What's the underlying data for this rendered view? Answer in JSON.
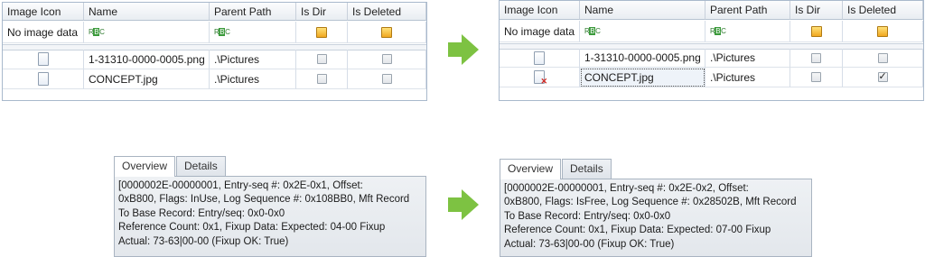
{
  "columns": [
    "Image Icon",
    "Name",
    "Parent Path",
    "Is Dir",
    "Is Deleted"
  ],
  "filter_row": {
    "image_icon": "No image data"
  },
  "before": {
    "rows": [
      {
        "name": "1-31310-0000-0005.png",
        "parent_path": ".\\Pictures",
        "is_dir": false,
        "is_deleted": false,
        "icon": "file-icon"
      },
      {
        "name": "CONCEPT.jpg",
        "parent_path": ".\\Pictures",
        "is_dir": false,
        "is_deleted": false,
        "icon": "file-icon"
      }
    ],
    "tabs": [
      "Overview",
      "Details"
    ],
    "active_tab": "Overview",
    "overview_lines": [
      "[0000002E-00000001, Entry-seq #: 0x2E-0x1, Offset:",
      "0xB800, Flags: InUse, Log Sequence #: 0x108BB0, Mft Record",
      "To Base Record: Entry/seq: 0x0-0x0",
      "Reference Count: 0x1, Fixup Data: Expected: 04-00 Fixup",
      "Actual: 73-63|00-00 (Fixup OK: True)"
    ]
  },
  "after": {
    "rows": [
      {
        "name": "1-31310-0000-0005.png",
        "parent_path": ".\\Pictures",
        "is_dir": false,
        "is_deleted": false,
        "icon": "file-icon"
      },
      {
        "name": "CONCEPT.jpg",
        "parent_path": ".\\Pictures",
        "is_dir": false,
        "is_deleted": true,
        "icon": "deleted-file-icon"
      }
    ],
    "tabs": [
      "Overview",
      "Details"
    ],
    "active_tab": "Overview",
    "overview_lines": [
      "[0000002E-00000001, Entry-seq #: 0x2E-0x2, Offset:",
      "0xB800, Flags: IsFree, Log Sequence #: 0x28502B, Mft Record",
      "To Base Record: Entry/seq: 0x0-0x0",
      "Reference Count: 0x1, Fixup Data: Expected: 07-00 Fixup",
      "Actual: 73-63|00-00 (Fixup OK: True)"
    ]
  },
  "colors": {
    "arrow": "#7dc242",
    "grid_border": "#a9b9cc",
    "filter_check": "#f1a71f"
  }
}
